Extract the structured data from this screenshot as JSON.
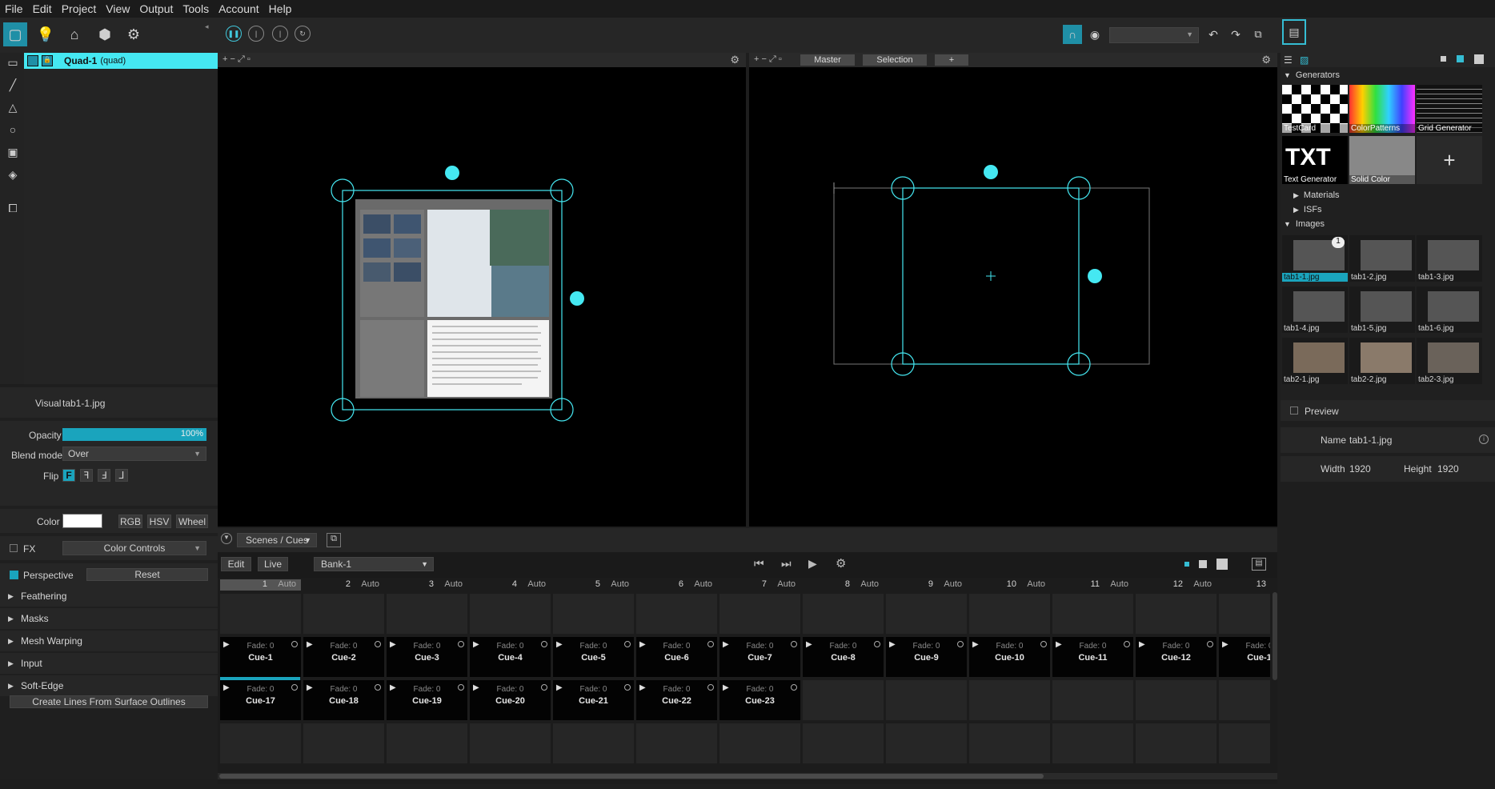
{
  "menu": [
    "File",
    "Edit",
    "Project",
    "View",
    "Output",
    "Tools",
    "Account",
    "Help"
  ],
  "layer": {
    "name": "Quad-1",
    "type": "(quad)"
  },
  "props": {
    "visual_label": "Visual",
    "visual_value": "tab1-1.jpg",
    "opacity_label": "Opacity",
    "opacity_value": "100%",
    "opacity_level": 1.0,
    "blend_label": "Blend mode",
    "blend_value": "Over",
    "flip_label": "Flip",
    "color_label": "Color",
    "rgb": "RGB",
    "hsv": "HSV",
    "wheel": "Wheel",
    "fx_label": "FX",
    "fx_value": "Color Controls",
    "perspective": "Perspective",
    "reset": "Reset",
    "sections": [
      "Feathering",
      "Masks",
      "Mesh Warping",
      "Input",
      "Soft-Edge"
    ],
    "create_lines": "Create Lines From Surface Outlines"
  },
  "right_view": {
    "tab_master": "Master",
    "tab_selection": "Selection",
    "tab_add": "+"
  },
  "library": {
    "generators_title": "Generators",
    "generators": [
      "TestCard",
      "ColorPatterns",
      "Grid Generator",
      "Text Generator",
      "Solid Color"
    ],
    "txt": "TXT",
    "materials": "Materials",
    "isfs": "ISFs",
    "images_title": "Images",
    "images": [
      "tab1-1.jpg",
      "tab1-2.jpg",
      "tab1-3.jpg",
      "tab1-4.jpg",
      "tab1-5.jpg",
      "tab1-6.jpg",
      "tab2-1.jpg",
      "tab2-2.jpg",
      "tab2-3.jpg"
    ],
    "badge": "1",
    "preview": "Preview",
    "name_label": "Name",
    "name_value": "tab1-1.jpg",
    "width_label": "Width",
    "width_value": "1920",
    "height_label": "Height",
    "height_value": "1920"
  },
  "cues_panel": {
    "mode": "Scenes / Cues",
    "edit": "Edit",
    "live": "Live",
    "bank": "Bank-1",
    "fade": "Fade: 0",
    "auto": "Auto",
    "columns": [
      "1",
      "2",
      "3",
      "4",
      "5",
      "6",
      "7",
      "8",
      "9",
      "10",
      "11",
      "12",
      "13"
    ],
    "row1": [
      "Cue-1",
      "Cue-2",
      "Cue-3",
      "Cue-4",
      "Cue-5",
      "Cue-6",
      "Cue-7",
      "Cue-8",
      "Cue-9",
      "Cue-10",
      "Cue-11",
      "Cue-12",
      "Cue-1"
    ],
    "row2": [
      "Cue-17",
      "Cue-18",
      "Cue-19",
      "Cue-20",
      "Cue-21",
      "Cue-22",
      "Cue-23"
    ]
  },
  "colors": {
    "accent": "#35bdd3",
    "layer_highlight": "#45e8f2"
  }
}
